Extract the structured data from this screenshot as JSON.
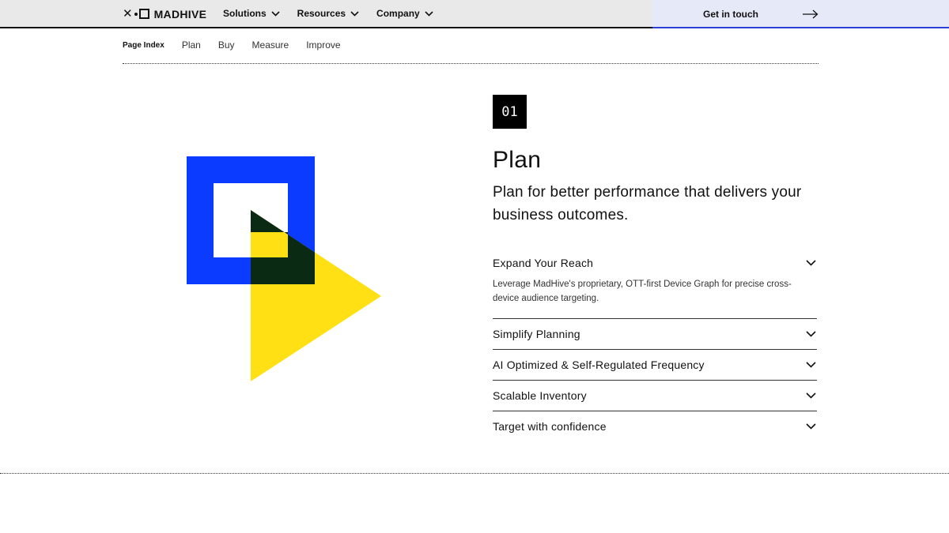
{
  "header": {
    "logo_text": "MADHIVE",
    "menu": [
      {
        "label": "Solutions"
      },
      {
        "label": "Resources"
      },
      {
        "label": "Company"
      }
    ],
    "cta_label": "Get in touch"
  },
  "page_index": {
    "title": "Page Index",
    "links": [
      "Plan",
      "Buy",
      "Measure",
      "Improve"
    ]
  },
  "illustration": {
    "square_color": "#0a3bff",
    "triangle_color": "#ffe014",
    "overlap_color": "#0a2a14"
  },
  "section": {
    "number": "01",
    "title": "Plan",
    "subtitle": "Plan for better performance that delivers your business outcomes.",
    "accordion": [
      {
        "label": "Expand Your Reach",
        "body": "Leverage MadHive's proprietary, OTT-first Device Graph for precise cross-device audience targeting.",
        "expanded": true
      },
      {
        "label": "Simplify Planning",
        "expanded": false
      },
      {
        "label": "AI Optimized & Self-Regulated Frequency",
        "expanded": false
      },
      {
        "label": "Scalable Inventory",
        "expanded": false
      },
      {
        "label": "Target with confidence",
        "expanded": false
      }
    ]
  }
}
